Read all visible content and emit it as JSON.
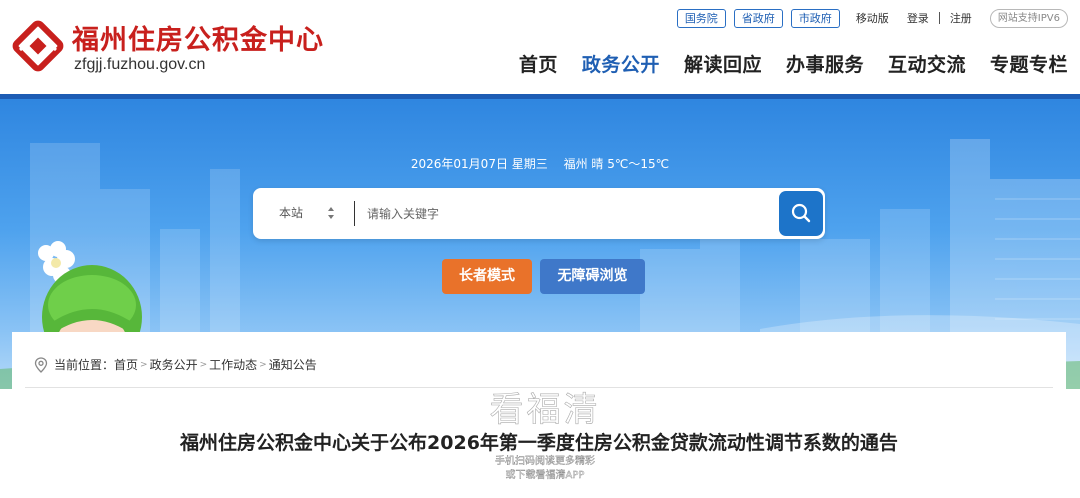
{
  "header": {
    "site_title": "福州住房公积金中心",
    "site_domain": "zfgjj.fuzhou.gov.cn",
    "top_links": {
      "gov1": "国务院",
      "gov2": "省政府",
      "gov3": "市政府",
      "mobile": "移动版",
      "login": "登录",
      "register": "注册",
      "ipv6": "网站支持IPV6"
    },
    "nav": [
      "首页",
      "政务公开",
      "解读回应",
      "办事服务",
      "互动交流",
      "专题专栏"
    ],
    "active_nav": "政务公开"
  },
  "hero": {
    "date": "2026年01月07日 星期三",
    "weather": "福州 晴 5℃～15℃",
    "search": {
      "scope": "本站",
      "placeholder": "请输入关键字",
      "icon": "search-icon"
    },
    "elder_mode_label": "长者模式",
    "accessibility_label": "无障碍浏览"
  },
  "content": {
    "breadcrumb": {
      "prefix": "当前位置：",
      "items": [
        "首页",
        "政务公开",
        "工作动态",
        "通知公告"
      ],
      "separator": ">"
    },
    "article_title": "福州住房公积金中心关于公布2026年第一季度住房公积金贷款流动性调节系数的通告"
  },
  "watermark": {
    "brand": "看福清",
    "line1": "手机扫码阅读更多精彩",
    "line2": "或下载看福清APP"
  },
  "colors": {
    "brand_red": "#c8201d",
    "nav_blue": "#1f5fb3",
    "hero_blue": "#2f86e0",
    "elder_orange": "#e9722a",
    "access_blue": "#3f78c9",
    "search_blue": "#1d74c9"
  }
}
